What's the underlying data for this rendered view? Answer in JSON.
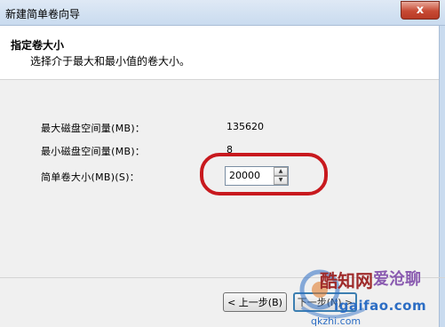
{
  "window": {
    "title": "新建简单卷向导",
    "close_glyph": "x"
  },
  "header": {
    "title": "指定卷大小",
    "subtitle": "选择介于最大和最小值的卷大小。"
  },
  "fields": {
    "max_label": "最大磁盘空间量(MB)：",
    "max_value": "135620",
    "min_label": "最小磁盘空间量(MB)：",
    "min_value": "8",
    "size_label": "简单卷大小(MB)(S)：",
    "size_value": "20000"
  },
  "buttons": {
    "back_label": "< 上一步(B)",
    "next_label": "下一步(N) >"
  },
  "watermark": {
    "text_a": "酷知网",
    "text_b": "爱沧聊",
    "text_c": "igaifao.com",
    "text_d": "qkzhi.com"
  },
  "colors": {
    "highlight": "#c8191e",
    "accent": "#3c7fb1"
  }
}
